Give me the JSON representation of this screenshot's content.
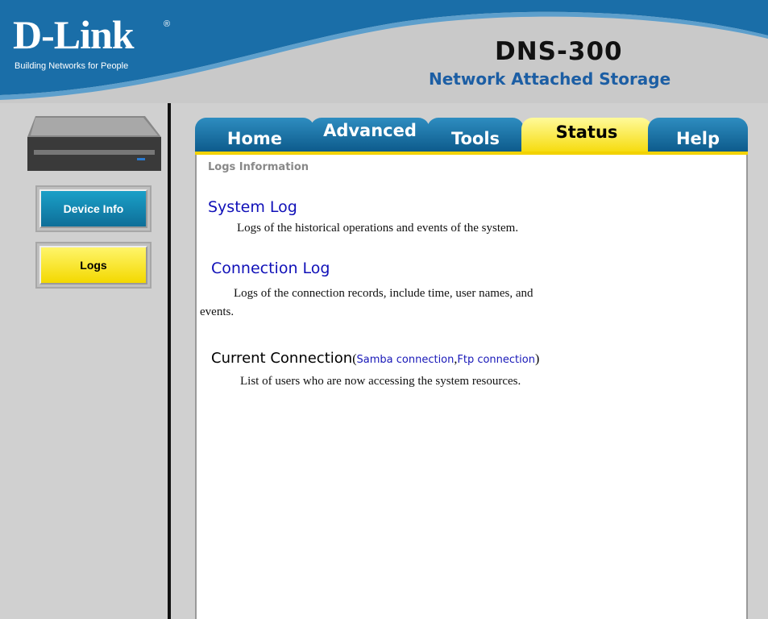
{
  "header": {
    "logo": "D-Link",
    "tagline": "Building Networks for People",
    "model": "DNS-300",
    "product": "Network Attached Storage"
  },
  "sidebar": {
    "items": [
      {
        "label": "Device Info",
        "active": false
      },
      {
        "label": "Logs",
        "active": true
      }
    ]
  },
  "tabs": [
    {
      "label": "Home"
    },
    {
      "label": "Advanced"
    },
    {
      "label": "Tools"
    },
    {
      "label": "Status",
      "active": true
    },
    {
      "label": "Help"
    }
  ],
  "main": {
    "breadcrumb": "Logs Information",
    "system_log": {
      "title": "System Log",
      "desc": "Logs of the historical operations and events of the system."
    },
    "connection_log": {
      "title": "Connection Log",
      "desc_line1": "Logs of the connection records, include time, user names, and",
      "desc_line2": "events."
    },
    "current_connection": {
      "title": "Current Connection",
      "open": "(",
      "samba": "Samba connection",
      "comma": ",",
      "ftp": "Ftp connection",
      "close": ")",
      "desc": "List of users who are now accessing the system resources."
    }
  },
  "colors": {
    "header_blue": "#1a6ea8",
    "tab_blue": "#0d5b8c",
    "tab_active": "#f6dc10",
    "link": "#1010b8"
  }
}
